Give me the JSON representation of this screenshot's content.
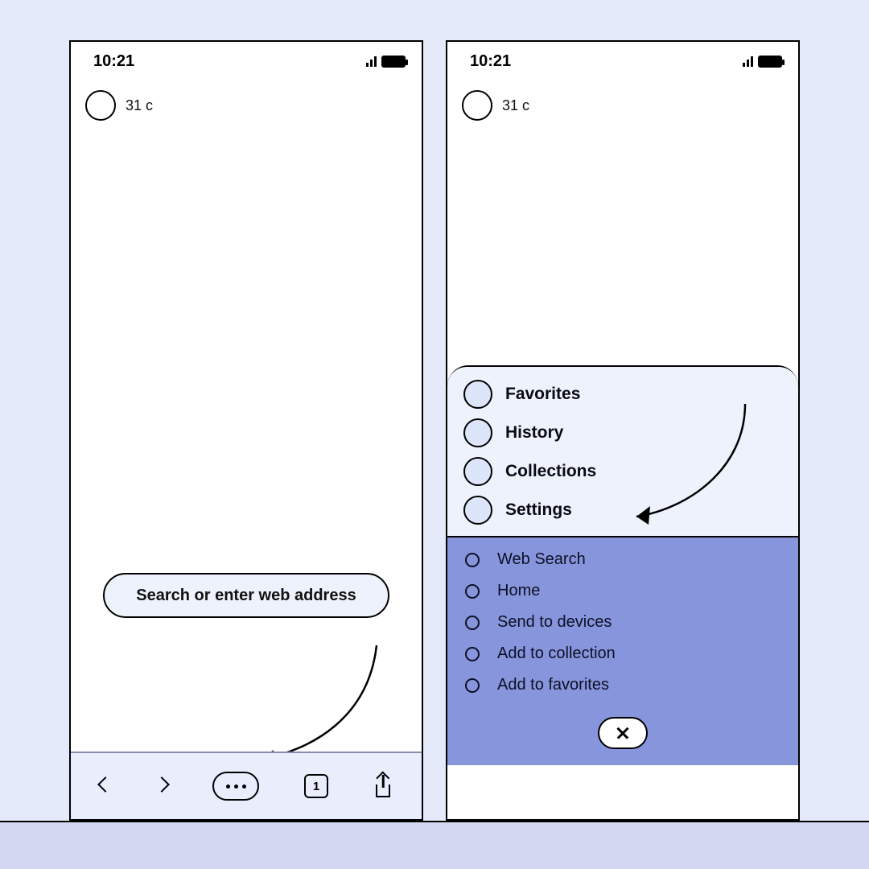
{
  "status": {
    "time": "10:21"
  },
  "header": {
    "label": "31 c"
  },
  "addressbar": {
    "placeholder": "Search or enter web address"
  },
  "bottombar": {
    "tabs_count": "1"
  },
  "sheet": {
    "primary": [
      {
        "label": "Favorites"
      },
      {
        "label": "History"
      },
      {
        "label": "Collections"
      },
      {
        "label": "Settings"
      }
    ],
    "options": [
      {
        "label": "Web Search"
      },
      {
        "label": "Home"
      },
      {
        "label": "Send to devices"
      },
      {
        "label": "Add to collection"
      },
      {
        "label": "Add to favorites"
      }
    ]
  }
}
